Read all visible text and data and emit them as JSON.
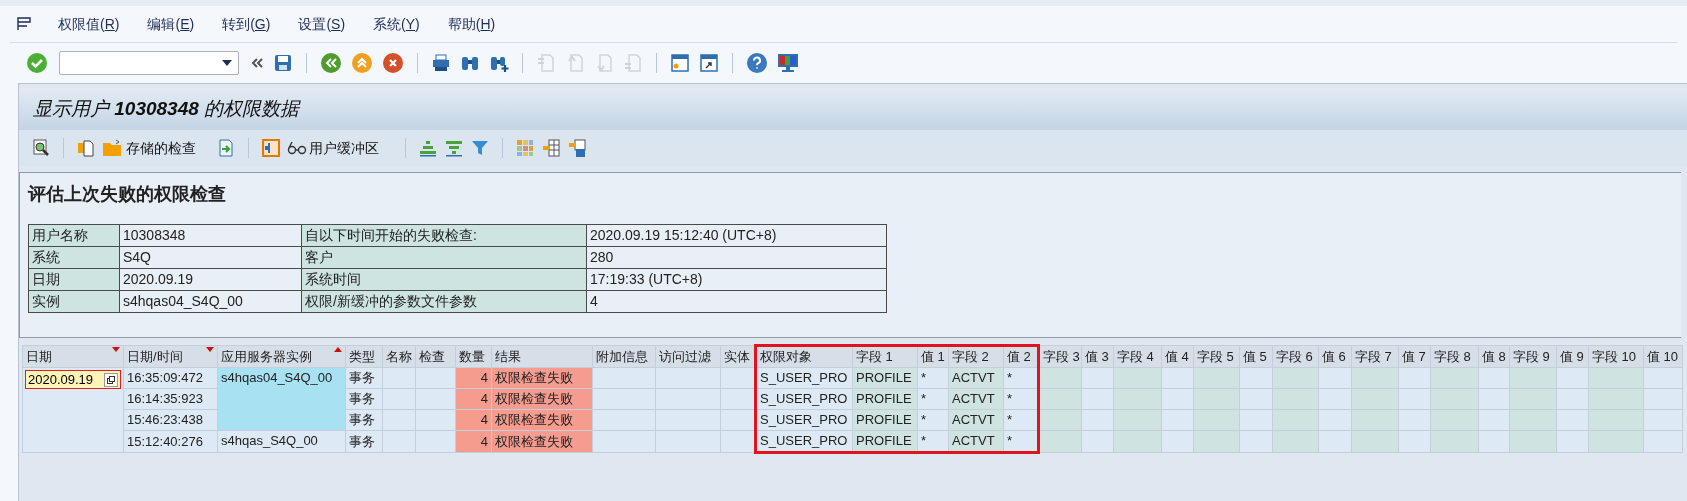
{
  "menu": [
    {
      "label": "权限值(R)"
    },
    {
      "label": "编辑(E)"
    },
    {
      "label": "转到(G)"
    },
    {
      "label": "设置(S)"
    },
    {
      "label": "系统(Y)"
    },
    {
      "label": "帮助(H)"
    }
  ],
  "main_toolbar": [
    {
      "kind": "button",
      "disabled": false
    },
    {
      "kind": "field"
    },
    {
      "kind": "button",
      "disabled": false
    },
    {
      "kind": "button",
      "disabled": false
    },
    {
      "kind": "separator"
    },
    {
      "kind": "button",
      "disabled": false
    },
    {
      "kind": "button",
      "disabled": false
    },
    {
      "kind": "button",
      "disabled": false
    },
    {
      "kind": "separator"
    },
    {
      "kind": "button",
      "disabled": false
    },
    {
      "kind": "button",
      "disabled": false
    },
    {
      "kind": "button",
      "disabled": false
    },
    {
      "kind": "separator"
    },
    {
      "kind": "button",
      "disabled": true
    },
    {
      "kind": "button",
      "disabled": true
    },
    {
      "kind": "button",
      "disabled": true
    },
    {
      "kind": "button",
      "disabled": true
    },
    {
      "kind": "separator"
    },
    {
      "kind": "button",
      "disabled": false
    },
    {
      "kind": "button",
      "disabled": false
    },
    {
      "kind": "separator"
    },
    {
      "kind": "button",
      "disabled": false
    },
    {
      "kind": "button",
      "disabled": false
    }
  ],
  "title": "显示用户 **10308348** 的权限数据",
  "app_toolbar": [
    {
      "kind": "icon"
    },
    {
      "kind": "separator"
    },
    {
      "kind": "icon"
    },
    {
      "kind": "labeled",
      "label": "存储的检查"
    },
    {
      "kind": "icon"
    },
    {
      "kind": "separator"
    },
    {
      "kind": "icon"
    },
    {
      "kind": "labeled",
      "label": "用户缓冲区"
    },
    {
      "kind": "separator"
    },
    {
      "kind": "icon"
    },
    {
      "kind": "icon"
    },
    {
      "kind": "icon"
    },
    {
      "kind": "separator"
    },
    {
      "kind": "icon"
    },
    {
      "kind": "icon"
    },
    {
      "kind": "icon"
    }
  ],
  "info": {
    "heading": "评估上次失败的权限检查",
    "rows": [
      {
        "label_1": "用户名称",
        "value_1": "10308348",
        "label_2": "自以下时间开始的失败检查:",
        "value_2": "2020.09.19 15:12:40 (UTC+8)"
      },
      {
        "label_1": "系统",
        "value_1": "S4Q",
        "label_2": "客户",
        "value_2": "280"
      },
      {
        "label_1": "日期",
        "value_1": "2020.09.19",
        "label_2": "系统时间",
        "value_2": "17:19:33 (UTC+8)"
      },
      {
        "label_1": "实例",
        "value_1": "s4hqas04_S4Q_00",
        "label_2": "权限/新缓冲的参数文件参数",
        "value_2": "4"
      }
    ]
  },
  "grid": {
    "columns": [
      {
        "label": "日期",
        "kind": "date",
        "sorted_desc": true,
        "sorted_asc": false,
        "framed": false
      },
      {
        "label": "日期/时间",
        "kind": "time",
        "sorted_desc": true,
        "sorted_asc": false,
        "framed": false
      },
      {
        "label": "应用服务器实例",
        "kind": "server",
        "sorted_desc": false,
        "sorted_asc": true,
        "framed": false
      },
      {
        "label": "类型",
        "kind": "type",
        "sorted_desc": false,
        "sorted_asc": false,
        "framed": false
      },
      {
        "label": "名称",
        "kind": "empty",
        "sorted_desc": false,
        "sorted_asc": false,
        "framed": false
      },
      {
        "label": "检查",
        "kind": "empty",
        "sorted_desc": false,
        "sorted_asc": false,
        "framed": false
      },
      {
        "label": "数量",
        "kind": "count",
        "sorted_desc": false,
        "sorted_asc": false,
        "framed": false
      },
      {
        "label": "结果",
        "kind": "result",
        "sorted_desc": false,
        "sorted_asc": false,
        "framed": false
      },
      {
        "label": "附加信息",
        "kind": "empty",
        "sorted_desc": false,
        "sorted_asc": false,
        "framed": false
      },
      {
        "label": "访问过滤",
        "kind": "empty",
        "sorted_desc": false,
        "sorted_asc": false,
        "framed": false
      },
      {
        "label": "实体",
        "kind": "empty",
        "sorted_desc": false,
        "sorted_asc": false,
        "framed": false
      },
      {
        "label": "权限对象",
        "kind": "object",
        "sorted_desc": false,
        "sorted_asc": false,
        "framed": true
      },
      {
        "label": "字段 1",
        "kind": "field",
        "sorted_desc": false,
        "sorted_asc": false,
        "framed": true
      },
      {
        "label": "值 1",
        "kind": "value",
        "sorted_desc": false,
        "sorted_asc": false,
        "framed": true
      },
      {
        "label": "字段 2",
        "kind": "field",
        "sorted_desc": false,
        "sorted_asc": false,
        "framed": true
      },
      {
        "label": "值 2",
        "kind": "value",
        "sorted_desc": false,
        "sorted_asc": false,
        "framed": true
      },
      {
        "label": "字段 3",
        "kind": "field",
        "sorted_desc": false,
        "sorted_asc": false,
        "framed": false
      },
      {
        "label": "值 3",
        "kind": "value",
        "sorted_desc": false,
        "sorted_asc": false,
        "framed": false
      },
      {
        "label": "字段 4",
        "kind": "field",
        "sorted_desc": false,
        "sorted_asc": false,
        "framed": false
      },
      {
        "label": "值 4",
        "kind": "value",
        "sorted_desc": false,
        "sorted_asc": false,
        "framed": false
      },
      {
        "label": "字段 5",
        "kind": "field",
        "sorted_desc": false,
        "sorted_asc": false,
        "framed": false
      },
      {
        "label": "值 5",
        "kind": "value",
        "sorted_desc": false,
        "sorted_asc": false,
        "framed": false
      },
      {
        "label": "字段 6",
        "kind": "field",
        "sorted_desc": false,
        "sorted_asc": false,
        "framed": false
      },
      {
        "label": "值 6",
        "kind": "value",
        "sorted_desc": false,
        "sorted_asc": false,
        "framed": false
      },
      {
        "label": "字段 7",
        "kind": "field",
        "sorted_desc": false,
        "sorted_asc": false,
        "framed": false
      },
      {
        "label": "值 7",
        "kind": "value",
        "sorted_desc": false,
        "sorted_asc": false,
        "framed": false
      },
      {
        "label": "字段 8",
        "kind": "field",
        "sorted_desc": false,
        "sorted_asc": false,
        "framed": false
      },
      {
        "label": "值 8",
        "kind": "value",
        "sorted_desc": false,
        "sorted_asc": false,
        "framed": false
      },
      {
        "label": "字段 9",
        "kind": "field",
        "sorted_desc": false,
        "sorted_asc": false,
        "framed": false
      },
      {
        "label": "值 9",
        "kind": "value",
        "sorted_desc": false,
        "sorted_asc": false,
        "framed": false
      },
      {
        "label": "字段 10",
        "kind": "field",
        "sorted_desc": false,
        "sorted_asc": false,
        "framed": false
      },
      {
        "label": "值 10",
        "kind": "value",
        "sorted_desc": false,
        "sorted_asc": false,
        "framed": false
      }
    ],
    "date_groups": [
      {
        "date": "2020.09.19",
        "focused": true,
        "server_groups": [
          {
            "server": "s4hqas04_S4Q_00",
            "highlighted": true,
            "rows": [
              {
                "time": "16:35:09:472",
                "type": "事务",
                "count": "4",
                "result": "权限检查失败",
                "object": "S_USER_PRO",
                "fields": [
                  {
                    "field": "PROFILE",
                    "value": "*"
                  },
                  {
                    "field": "ACTVT",
                    "value": "*"
                  }
                ]
              },
              {
                "time": "16:14:35:923",
                "type": "事务",
                "count": "4",
                "result": "权限检查失败",
                "object": "S_USER_PRO",
                "fields": [
                  {
                    "field": "PROFILE",
                    "value": "*"
                  },
                  {
                    "field": "ACTVT",
                    "value": "*"
                  }
                ]
              },
              {
                "time": "15:46:23:438",
                "type": "事务",
                "count": "4",
                "result": "权限检查失败",
                "object": "S_USER_PRO",
                "fields": [
                  {
                    "field": "PROFILE",
                    "value": "*"
                  },
                  {
                    "field": "ACTVT",
                    "value": "*"
                  }
                ]
              }
            ]
          },
          {
            "server": "s4hqas_S4Q_00",
            "highlighted": false,
            "rows": [
              {
                "time": "15:12:40:276",
                "type": "事务",
                "count": "4",
                "result": "权限检查失败",
                "object": "S_USER_PRO",
                "fields": [
                  {
                    "field": "PROFILE",
                    "value": "*"
                  },
                  {
                    "field": "ACTVT",
                    "value": "*"
                  }
                ]
              }
            ]
          }
        ]
      }
    ]
  }
}
